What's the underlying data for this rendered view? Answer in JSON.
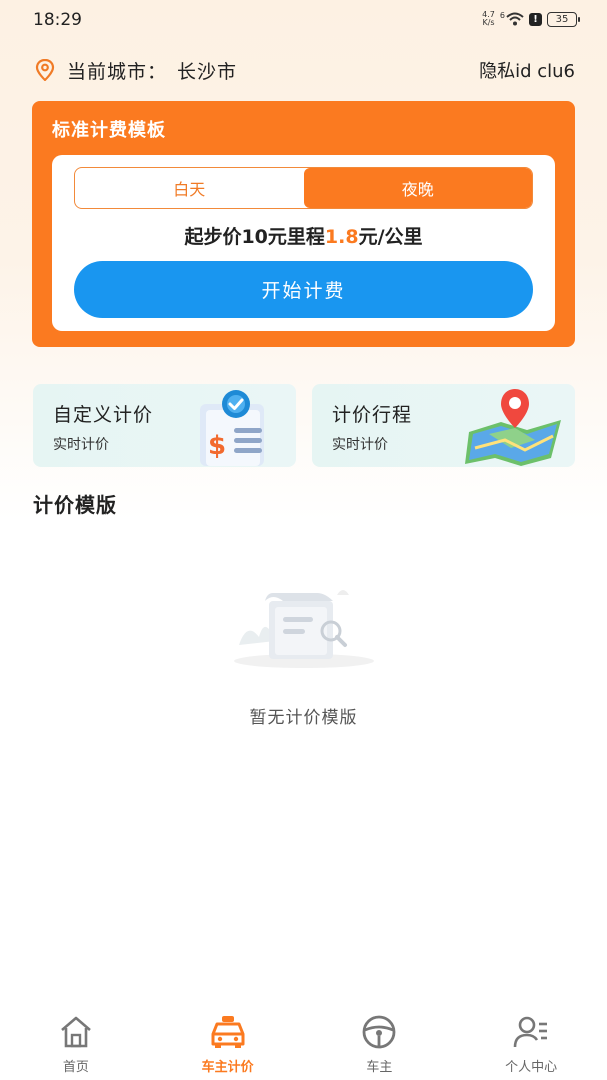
{
  "status_bar": {
    "time": "18:29",
    "net_speed_value": "4.7",
    "net_speed_unit": "K/s",
    "signal_label": "6",
    "battery": "35"
  },
  "header": {
    "location_icon": "location-pin-icon",
    "city_label": "当前城市：",
    "city_name": "长沙市",
    "privacy_id": "隐私id clu6"
  },
  "template_card": {
    "title": "标准计费模板",
    "tabs": [
      {
        "label": "白天",
        "active": false
      },
      {
        "label": "夜晚",
        "active": true
      }
    ],
    "price_prefix": "起步价10元里程",
    "price_highlight": "1.8",
    "price_suffix": "元/公里",
    "start_button": "开始计费"
  },
  "features": [
    {
      "title": "自定义计价",
      "subtitle": "实时计价",
      "icon": "price-list-icon"
    },
    {
      "title": "计价行程",
      "subtitle": "实时计价",
      "icon": "map-pin-icon"
    }
  ],
  "section": {
    "title": "计价模版"
  },
  "empty_state": {
    "icon": "empty-document-icon",
    "text": "暂无计价模版"
  },
  "bottom_nav": [
    {
      "label": "首页",
      "icon": "home-icon",
      "active": false
    },
    {
      "label": "车主计价",
      "icon": "taxi-icon",
      "active": true
    },
    {
      "label": "车主",
      "icon": "steering-wheel-icon",
      "active": false
    },
    {
      "label": "个人中心",
      "icon": "user-icon",
      "active": false
    }
  ],
  "colors": {
    "accent": "#fb7a20",
    "button_blue": "#1996f0",
    "feature_bg": "#e6f5f3"
  }
}
